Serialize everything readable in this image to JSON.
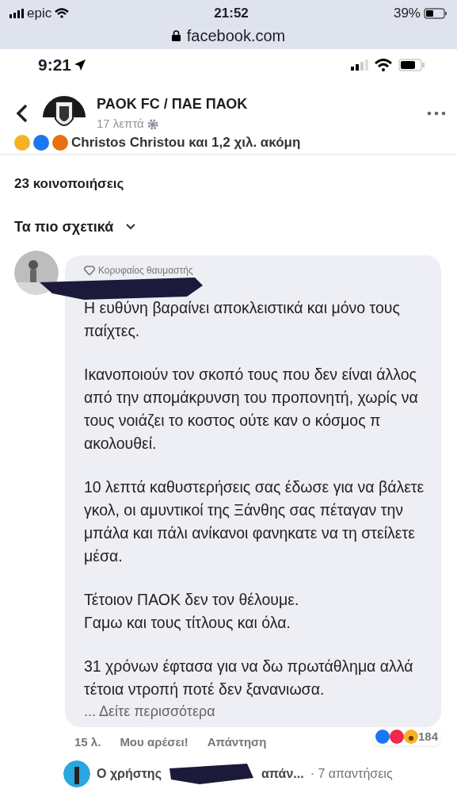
{
  "browser_status": {
    "carrier": "epic",
    "time": "21:52",
    "battery": "39%"
  },
  "address_bar": {
    "url": "facebook.com"
  },
  "phone_status": {
    "time": "9:21"
  },
  "post_header": {
    "page_name": "PAOK FC / ΠΑΕ ΠΑΟΚ",
    "time": "17 λεπτά"
  },
  "reactions_summary": {
    "text": "Christos Christou και 1,2 χιλ. ακόμη"
  },
  "shares": "23 κοινοποιήσεις",
  "sort": {
    "label": "Τα πιο σχετικά"
  },
  "comment": {
    "badge": "Κορυφαίος θαυμαστής",
    "redacted_name": true,
    "paragraphs": [
      [
        "Η ευθύνη βαραίνει αποκλειστικά και μόνο τους παίχτες."
      ],
      [
        "Ικανοποιούν τον σκοπό τους που δεν είναι άλλος από την απομάκρυνση του προπονητή, χωρίς να τους νοιάζει το κοστος ούτε καν ο κόσμος π ακολουθεί."
      ],
      [
        "10 λεπτά καθυστερήσεις σας έδωσε για να βάλετε γκολ, οι αμυντικοί της Ξάνθης σας πέταγαν την μπάλα και πάλι ανίκανοι φανηκατε να τη στείλετε μέσα."
      ],
      [
        "Τέτοιον ΠΑΟΚ δεν τον θέλουμε.",
        "Γαμω και τους τίτλους και όλα."
      ],
      [
        "31 χρόνων έφτασα για να δω πρωτάθλημα αλλά τέτοια ντροπή ποτέ δεν ξανανιωσα."
      ]
    ],
    "see_more": "... Δείτε περισσότερα",
    "age": "15 λ.",
    "like": "Μου αρέσει!",
    "reply": "Απάντηση",
    "reaction_count": "184"
  },
  "replies_row": {
    "prefix": "Ο χρήστης",
    "suffix": "απάν...",
    "count": "· 7 απαντήσεις",
    "redacted_name": true
  }
}
